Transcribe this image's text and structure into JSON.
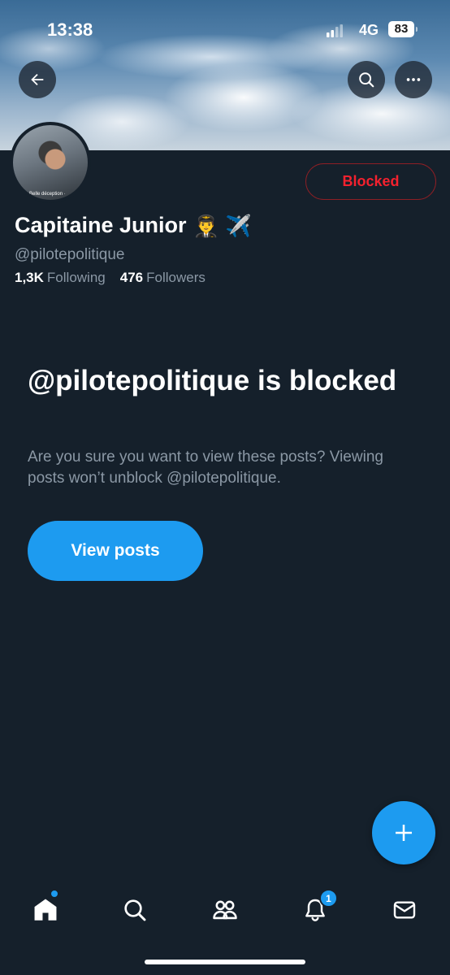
{
  "status_bar": {
    "time": "13:38",
    "network": "4G",
    "battery": "83"
  },
  "header": {
    "back_icon": "arrow-left-icon",
    "search_icon": "search-icon",
    "more_icon": "more-horizontal-icon"
  },
  "profile": {
    "avatar_caption": "Belle déception ·",
    "relationship_button": "Blocked",
    "display_name": "Capitaine Junior",
    "name_emojis": "👨‍✈️ ✈️",
    "handle": "@pilotepolitique",
    "following_count": "1,3K",
    "following_label": "Following",
    "followers_count": "476",
    "followers_label": "Followers"
  },
  "blocked_notice": {
    "title": "@pilotepolitique is blocked",
    "description": "Are you sure you want to view these posts? Viewing posts won’t unblock @pilotepolitique.",
    "button_label": "View posts"
  },
  "fab": {
    "icon": "plus-icon"
  },
  "tabbar": {
    "items": [
      {
        "name": "home",
        "icon": "home-icon"
      },
      {
        "name": "search",
        "icon": "search-icon"
      },
      {
        "name": "communities",
        "icon": "people-icon"
      },
      {
        "name": "notifications",
        "icon": "bell-icon"
      },
      {
        "name": "messages",
        "icon": "envelope-icon"
      }
    ],
    "notifications_badge": "1"
  },
  "colors": {
    "background": "#15202b",
    "accent": "#1d9bf0",
    "blocked_red": "#f4212e",
    "secondary_text": "#8b98a5"
  }
}
